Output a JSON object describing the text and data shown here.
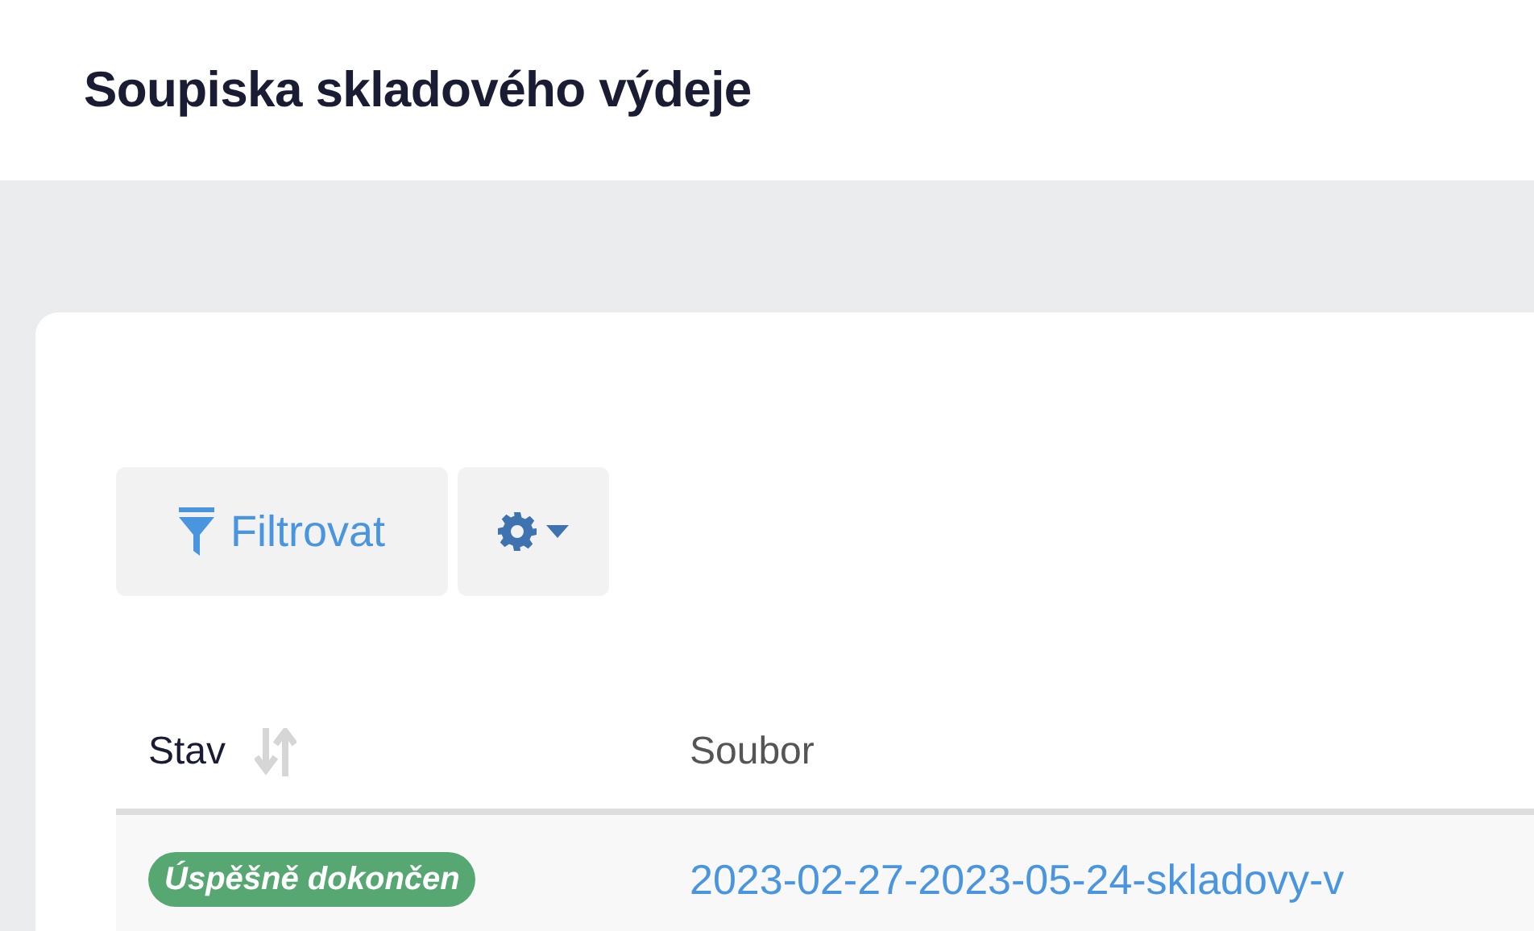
{
  "page_title": "Soupiska skladového výdeje",
  "toolbar": {
    "filter_button": "Filtrovat"
  },
  "table": {
    "columns": [
      {
        "label": "Stav",
        "sortable": true
      },
      {
        "label": "Soubor",
        "sortable": false
      }
    ],
    "rows": [
      {
        "status": {
          "label": "Úspěšně dokončen",
          "color": "#57a773"
        },
        "file": "2023-02-27-2023-05-24-skladovy-v"
      }
    ]
  }
}
